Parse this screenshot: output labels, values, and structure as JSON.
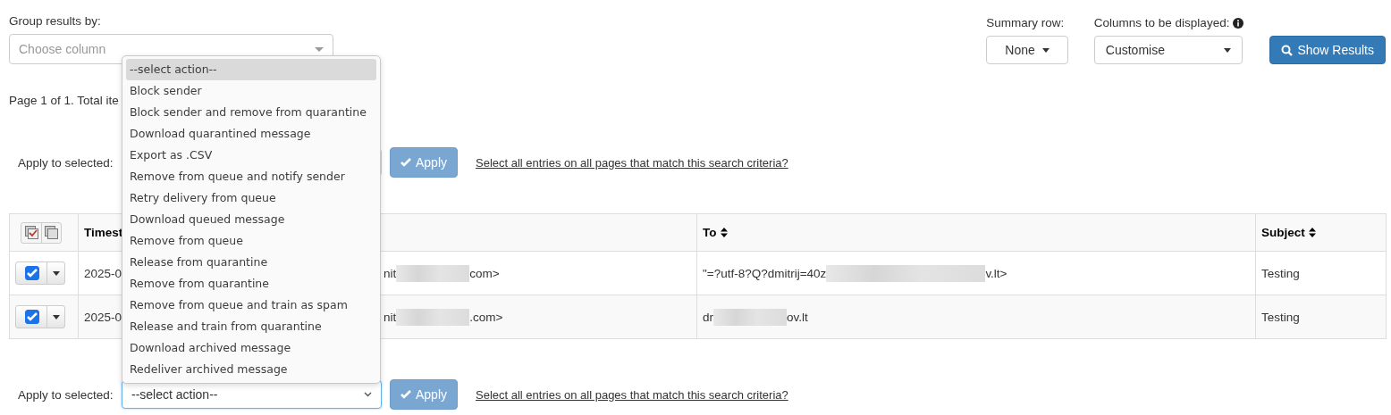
{
  "group_by": {
    "label": "Group results by:",
    "placeholder": "Choose column"
  },
  "summary_row": {
    "label": "Summary row:",
    "value": "None"
  },
  "columns_display": {
    "label": "Columns to be displayed:",
    "value": "Customise"
  },
  "show_results_button": "Show Results",
  "page_info": "Page 1 of 1. Total ite",
  "apply_top": {
    "label": "Apply to selected:",
    "button": "Apply",
    "link": "Select all entries on all pages that match this search criteria?"
  },
  "table": {
    "header": {
      "timestamp": "Timest",
      "to": "To",
      "subject": "Subject"
    },
    "rows": [
      {
        "checked": true,
        "timestamp": "2025-0",
        "from": [
          {
            "kind": "text",
            "text": "nit"
          },
          {
            "kind": "redacted"
          },
          {
            "kind": "text",
            "text": "com>"
          }
        ],
        "to": [
          {
            "kind": "text",
            "text": "\"=?utf-8?Q?dmitrij=40z"
          },
          {
            "kind": "redacted_long"
          },
          {
            "kind": "text",
            "text": "v.lt>"
          }
        ],
        "subject": "Testing"
      },
      {
        "checked": true,
        "timestamp": "2025-0",
        "from": [
          {
            "kind": "text",
            "text": "nit"
          },
          {
            "kind": "redacted"
          },
          {
            "kind": "text",
            "text": ".com>"
          }
        ],
        "to": [
          {
            "kind": "text",
            "text": "dr"
          },
          {
            "kind": "redacted"
          },
          {
            "kind": "text",
            "text": "ov.lt"
          }
        ],
        "subject": "Testing"
      }
    ]
  },
  "apply_bottom": {
    "label": "Apply to selected:",
    "value": "--select action--",
    "button": "Apply",
    "link": "Select all entries on all pages that match this search criteria?"
  },
  "action_options": [
    {
      "label": "--select action--",
      "selected": true
    },
    {
      "label": "Block sender",
      "selected": false
    },
    {
      "label": "Block sender and remove from quarantine",
      "selected": false
    },
    {
      "label": "Download quarantined message",
      "selected": false
    },
    {
      "label": "Export as .CSV",
      "selected": false
    },
    {
      "label": "Remove from queue and notify sender",
      "selected": false
    },
    {
      "label": "Retry delivery from queue",
      "selected": false
    },
    {
      "label": "Download queued message",
      "selected": false
    },
    {
      "label": "Remove from queue",
      "selected": false
    },
    {
      "label": "Release from quarantine",
      "selected": false
    },
    {
      "label": "Remove from quarantine",
      "selected": false
    },
    {
      "label": "Remove from queue and train as spam",
      "selected": false
    },
    {
      "label": "Release and train from quarantine",
      "selected": false
    },
    {
      "label": "Download archived message",
      "selected": false
    },
    {
      "label": "Redeliver archived message",
      "selected": false
    }
  ]
}
